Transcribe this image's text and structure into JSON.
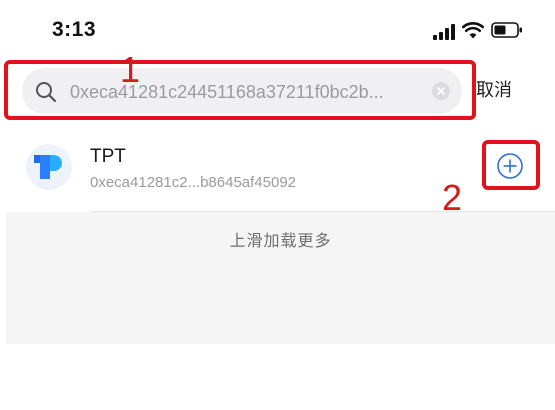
{
  "status_bar": {
    "time": "3:13"
  },
  "search": {
    "query": "0xeca41281c24451168a37211f0bc2b...",
    "cancel_label": "取消"
  },
  "token": {
    "name": "TPT",
    "address": "0xeca41281c2...b8645af45092"
  },
  "list": {
    "load_more_label": "上滑加载更多"
  },
  "annotations": {
    "step1": "1",
    "step2": "2"
  },
  "colors": {
    "annotation": "#e0121b",
    "accent": "#2f6fd6",
    "logo_blue": "#2980fe"
  },
  "icons": [
    "search-icon",
    "clear-icon",
    "plus-circle-icon",
    "tokenpocket-logo",
    "signal-icon",
    "wifi-icon",
    "battery-icon"
  ]
}
